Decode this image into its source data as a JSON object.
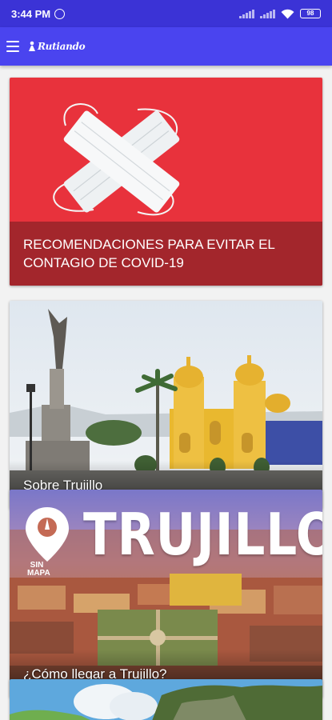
{
  "status_bar": {
    "time": "3:44 PM",
    "battery": "98"
  },
  "app_bar": {
    "logo_small": "www.trujillo",
    "logo_text": "Rutiando"
  },
  "cards": [
    {
      "caption": "RECOMENDACIONES PARA EVITAR EL CONTAGIO DE COVID-19"
    },
    {
      "caption": "Sobre Trujillo"
    },
    {
      "caption": "¿Cómo llegar a Trujillo?",
      "title_overlay": "TRUJILLO",
      "badge_line1": "SIN",
      "badge_line2": "MAPA"
    },
    {
      "caption": ""
    }
  ],
  "colors": {
    "status_bar": "#3b33d6",
    "app_bar": "#4a44ef",
    "covid_red": "#e8323c",
    "covid_caption": "#a3262c"
  }
}
